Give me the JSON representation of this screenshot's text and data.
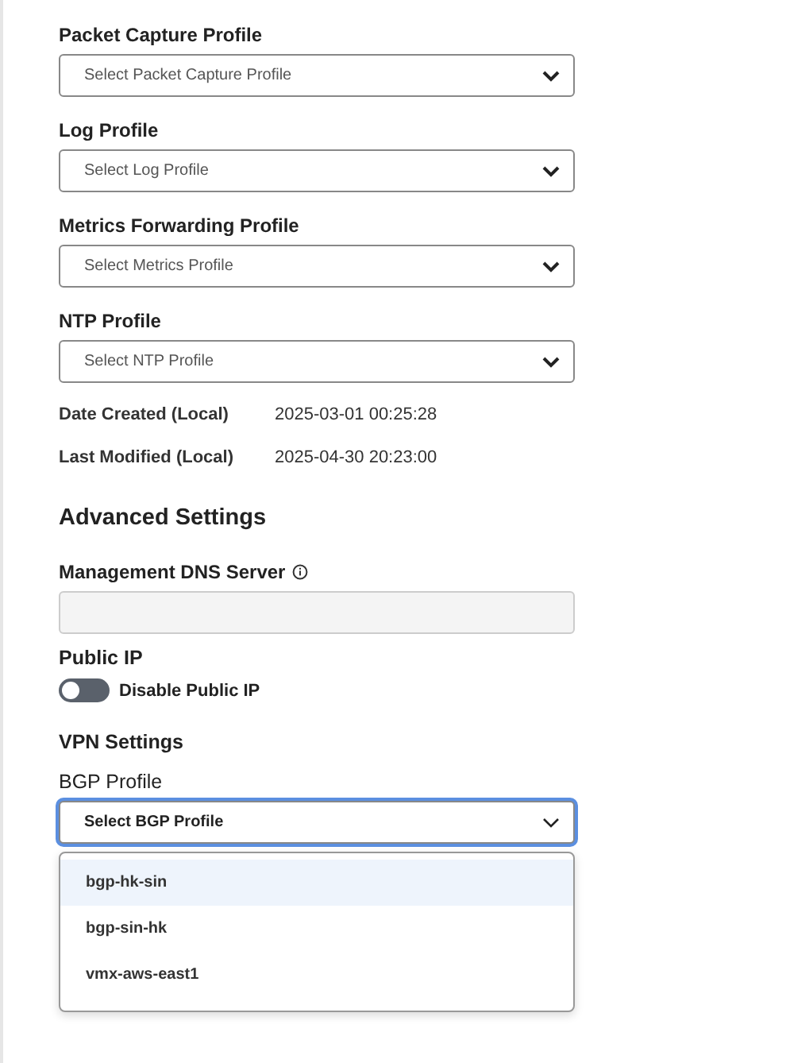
{
  "profile_selects": [
    {
      "label": "Packet Capture Profile",
      "placeholder": "Select Packet Capture Profile"
    },
    {
      "label": "Log Profile",
      "placeholder": "Select Log Profile"
    },
    {
      "label": "Metrics Forwarding Profile",
      "placeholder": "Select Metrics Profile"
    },
    {
      "label": "NTP Profile",
      "placeholder": "Select NTP Profile"
    }
  ],
  "meta": [
    {
      "label": "Date Created (Local)",
      "value": "2025-03-01 00:25:28"
    },
    {
      "label": "Last Modified (Local)",
      "value": "2025-04-30 20:23:00"
    }
  ],
  "advanced": {
    "title": "Advanced Settings",
    "dns": {
      "label": "Management DNS Server",
      "disabled": true
    }
  },
  "public_ip": {
    "heading": "Public IP",
    "toggle": {
      "label": "Disable Public IP",
      "on": false
    }
  },
  "vpn": {
    "heading": "VPN Settings",
    "bgp": {
      "label": "BGP Profile",
      "placeholder": "Select BGP Profile",
      "expanded": true,
      "options": [
        {
          "label": "bgp-hk-sin",
          "highlighted": true
        },
        {
          "label": "bgp-sin-hk",
          "highlighted": false
        },
        {
          "label": "vmx-aws-east1",
          "highlighted": false
        }
      ]
    }
  }
}
